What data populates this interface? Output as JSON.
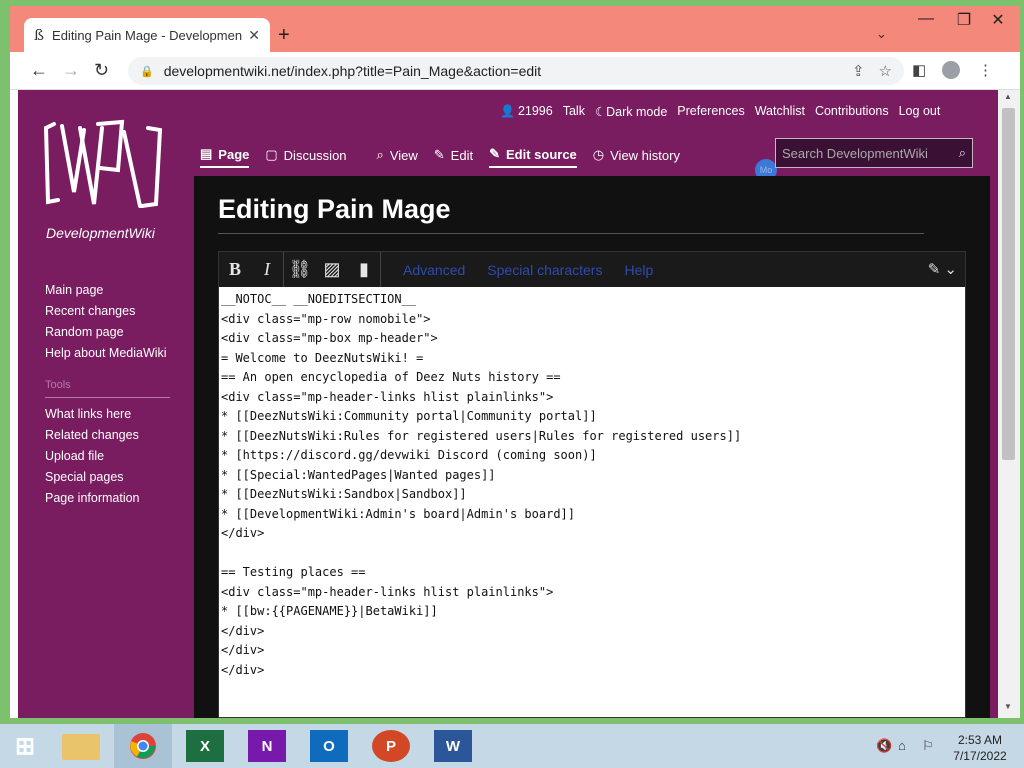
{
  "browser": {
    "tab_title": "Editing Pain Mage - Developmen",
    "tab_favicon": "ß",
    "url": "developmentwiki.net/index.php?title=Pain_Mage&action=edit"
  },
  "wiki": {
    "site_name": "DevelopmentWiki",
    "user_id": "21996",
    "user_links": [
      "Talk",
      "☾Dark mode",
      "Preferences",
      "Watchlist",
      "Contributions",
      "Log out"
    ],
    "nav_links": [
      "Main page",
      "Recent changes",
      "Random page",
      "Help about MediaWiki"
    ],
    "tools_heading": "Tools",
    "tool_links": [
      "What links here",
      "Related changes",
      "Upload file",
      "Special pages",
      "Page information"
    ],
    "tabs": {
      "page": "Page",
      "discussion": "Discussion",
      "view": "View",
      "edit": "Edit",
      "edit_source": "Edit source",
      "view_history": "View history"
    },
    "search_placeholder": "Search DevelopmentWiki",
    "bluedot_label": "Mo",
    "page_title": "Editing Pain Mage",
    "editor_tabs": [
      "Advanced",
      "Special characters",
      "Help"
    ],
    "source": "__NOTOC__ __NOEDITSECTION__\n<div class=\"mp-row nomobile\">\n<div class=\"mp-box mp-header\">\n= Welcome to DeezNutsWiki! =\n== An open encyclopedia of Deez Nuts history ==\n<div class=\"mp-header-links hlist plainlinks\">\n* [[DeezNutsWiki:Community portal|Community portal]]\n* [[DeezNutsWiki:Rules for registered users|Rules for registered users]]\n* [https://discord.gg/devwiki Discord (coming soon)]\n* [[Special:WantedPages|Wanted pages]]\n* [[DeezNutsWiki:Sandbox|Sandbox]]\n* [[DevelopmentWiki:Admin's board|Admin's board]]\n</div>\n\n== Testing places ==\n<div class=\"mp-header-links hlist plainlinks\">\n* [[bw:{{PAGENAME}}|BetaWiki]]\n</div>\n</div>\n</div>"
  },
  "taskbar": {
    "time": "2:53 AM",
    "date": "7/17/2022"
  },
  "colors": {
    "wiki_purple": "#7a1c60",
    "browser_frame": "#f4887a"
  }
}
